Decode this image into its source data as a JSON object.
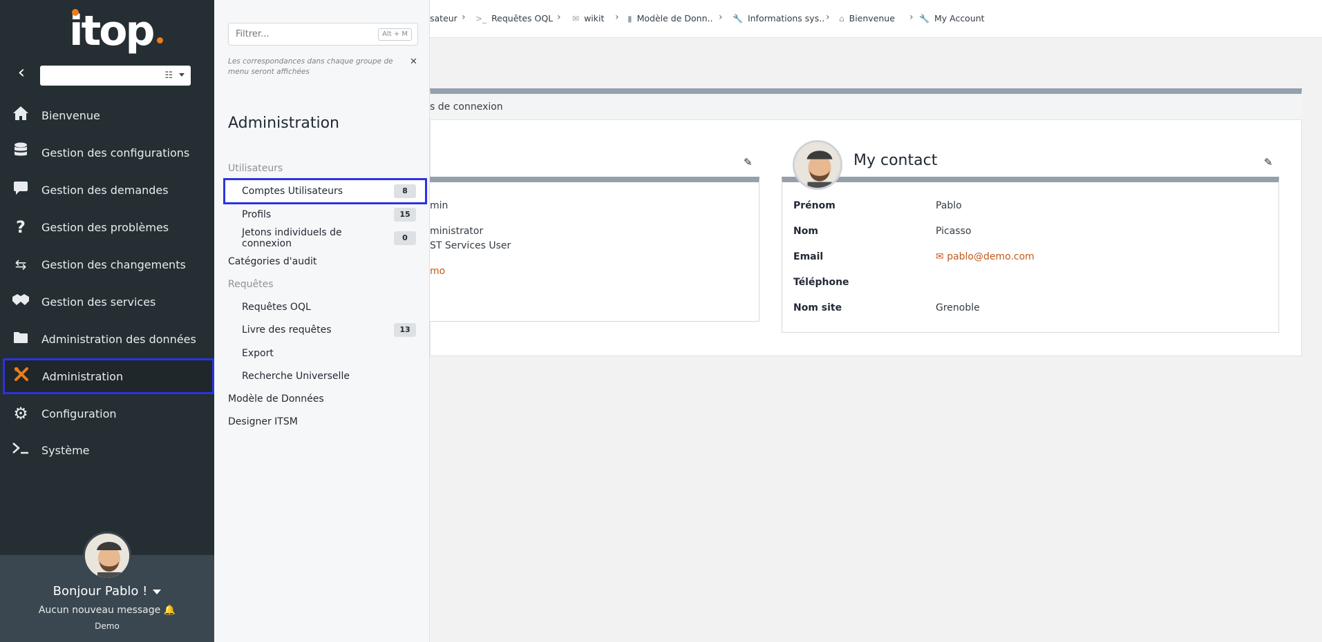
{
  "app": {
    "logo_text": "itop"
  },
  "sidebar": {
    "org_select_value": "",
    "items": [
      {
        "label": "Bienvenue",
        "icon": "home-icon"
      },
      {
        "label": "Gestion des configurations",
        "icon": "database-icon"
      },
      {
        "label": "Gestion des demandes",
        "icon": "comment-icon"
      },
      {
        "label": "Gestion des problèmes",
        "icon": "question-icon"
      },
      {
        "label": "Gestion des changements",
        "icon": "exchange-icon"
      },
      {
        "label": "Gestion des services",
        "icon": "handshake-icon"
      },
      {
        "label": "Administration des données",
        "icon": "folder-icon"
      },
      {
        "label": "Administration",
        "icon": "tools-icon",
        "active": true
      },
      {
        "label": "Configuration",
        "icon": "gear-icon"
      },
      {
        "label": "Système",
        "icon": "terminal-icon"
      }
    ],
    "user": {
      "greeting": "Bonjour Pablo !",
      "messages": "Aucun nouveau message",
      "organization": "Demo"
    }
  },
  "flyout": {
    "filter_placeholder": "Filtrer...",
    "filter_shortcut": "Alt + M",
    "filter_hint": "Les correspondances dans chaque groupe de menu seront affichées",
    "title": "Administration",
    "groups": [
      {
        "label": "Utilisateurs"
      },
      {
        "label": "Comptes Utilisateurs",
        "badge": "8"
      },
      {
        "label": "Profils",
        "badge": "15"
      },
      {
        "label": "Jetons individuels de connexion",
        "badge": "0"
      },
      {
        "label": "Catégories d'audit"
      },
      {
        "label": "Requêtes"
      },
      {
        "label": "Requêtes OQL"
      },
      {
        "label": "Livre des requêtes",
        "badge": "13"
      },
      {
        "label": "Export"
      },
      {
        "label": "Recherche Universelle"
      },
      {
        "label": "Modèle de Données"
      },
      {
        "label": "Designer ITSM"
      }
    ]
  },
  "breadcrumbs": [
    {
      "label": "sateur"
    },
    {
      "label": "Requêtes OQL"
    },
    {
      "label": "wikit"
    },
    {
      "label": "Modèle de Donn.."
    },
    {
      "label": "Informations sys.."
    },
    {
      "label": "Bienvenue"
    },
    {
      "label": "My Account"
    }
  ],
  "main": {
    "tab_label": "s de connexion",
    "left_card": {
      "rows": [
        "min",
        "ministrator",
        "ST Services User",
        "mo"
      ]
    },
    "contact_card": {
      "title": "My contact",
      "fields": [
        {
          "label": "Prénom",
          "value": "Pablo"
        },
        {
          "label": "Nom",
          "value": "Picasso"
        },
        {
          "label": "Email",
          "value": "pablo@demo.com"
        },
        {
          "label": "Téléphone",
          "value": ""
        },
        {
          "label": "Nom site",
          "value": "Grenoble"
        }
      ]
    }
  },
  "colors": {
    "sidebar_bg": "#252e33",
    "accent": "#ea7d1e",
    "highlight": "#2b33e0",
    "link": "#c35a1b"
  }
}
